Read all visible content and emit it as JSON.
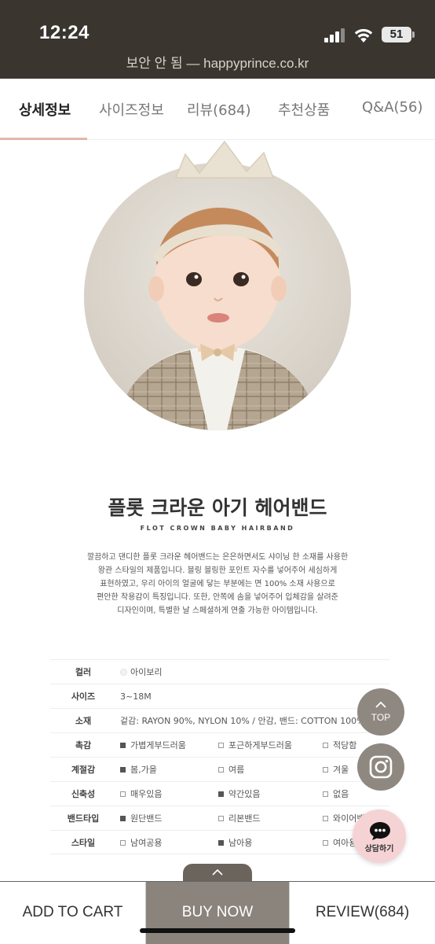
{
  "status": {
    "time": "12:24",
    "battery": "51"
  },
  "browser": {
    "url_text": "보안 안 됨 — happyprince.co.kr"
  },
  "tabs": [
    {
      "label": "상세정보",
      "active": true
    },
    {
      "label": "사이즈정보",
      "active": false
    },
    {
      "label": "리뷰(684)",
      "active": false
    },
    {
      "label": "추천상품",
      "active": false
    },
    {
      "label": "Q&A(56)",
      "active": false
    }
  ],
  "product": {
    "title_ko": "플롯 크라운 아기 헤어밴드",
    "title_en": "FLOT CROWN BABY HAIRBAND",
    "description": [
      "깔끔하고 댄디한 플롯 크라운 헤어밴드는 은은하면서도 샤이닝 한 소재를 사용한",
      "왕관 스타일의 제품입니다. 블링 블링한 포인트 자수를 넣어주어 세심하게",
      "표현하였고, 우리 아이의 얼굴에 닿는 부분에는 면 100% 소재 사용으로",
      "편안한 착용감이 특징입니다. 또한, 안쪽에 솜을 넣어주어 입체감을 살려준",
      "디자인이며, 특별한 날 스페셜하게 연출 가능한 아이템입니다."
    ]
  },
  "specs": {
    "color": {
      "label": "컬러",
      "value": "아이보리"
    },
    "size": {
      "label": "사이즈",
      "value": "3~18M"
    },
    "material": {
      "label": "소재",
      "value": "겉감: RAYON 90%, NYLON 10% / 안감, 밴드: COTTON 100%"
    },
    "texture": {
      "label": "촉감",
      "options": [
        {
          "text": "가볍게부드러움",
          "checked": true
        },
        {
          "text": "포근하게부드러움",
          "checked": false
        },
        {
          "text": "적당함",
          "checked": false
        }
      ]
    },
    "season": {
      "label": "계절감",
      "options": [
        {
          "text": "봄,가을",
          "checked": true
        },
        {
          "text": "여름",
          "checked": false
        },
        {
          "text": "겨울",
          "checked": false
        }
      ]
    },
    "stretch": {
      "label": "신축성",
      "options": [
        {
          "text": "매우있음",
          "checked": false
        },
        {
          "text": "약간있음",
          "checked": true
        },
        {
          "text": "없음",
          "checked": false
        }
      ]
    },
    "band_type": {
      "label": "밴드타입",
      "options": [
        {
          "text": "원단밴드",
          "checked": true
        },
        {
          "text": "리본밴드",
          "checked": false
        },
        {
          "text": "와이어밴",
          "checked": false
        }
      ]
    },
    "style": {
      "label": "스타일",
      "options": [
        {
          "text": "남여공용",
          "checked": false
        },
        {
          "text": "남아용",
          "checked": true
        },
        {
          "text": "여아용",
          "checked": false
        }
      ]
    }
  },
  "floating": {
    "top_label": "TOP",
    "chat_label": "상담하기"
  },
  "bottom_bar": {
    "cart": "ADD TO CART",
    "buy": "BUY NOW",
    "review": "REVIEW(684)"
  },
  "colors": {
    "header_bg": "#3a352f",
    "tab_indicator": "#e2b7a8",
    "button_gray": "#8a847c",
    "chat_pink": "#f5d3d4"
  }
}
